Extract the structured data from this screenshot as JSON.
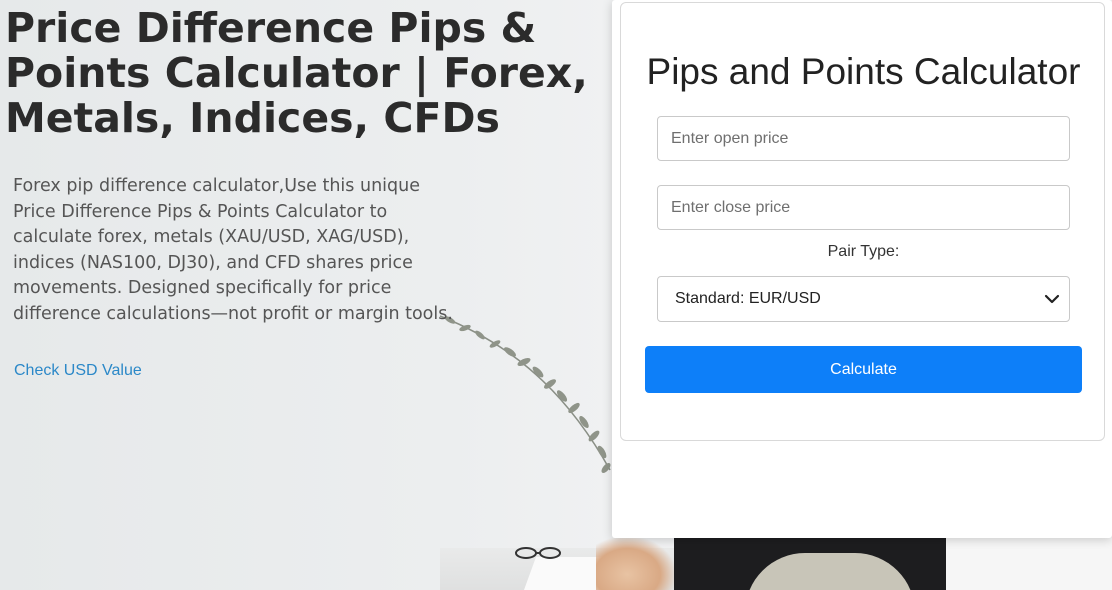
{
  "hero": {
    "title_line1": "Price Difference Pips &",
    "title_line2": "Points Calculator | Forex,",
    "title_line3": "Metals, Indices, CFDs",
    "description": "Forex pip difference calculator,Use this unique Price Difference Pips & Points Calculator to calculate forex, metals (XAU/USD, XAG/USD), indices (NAS100, DJ30), and CFD shares price movements. Designed specifically for price difference calculations—not profit or margin tools.",
    "link_label": "Check USD Value"
  },
  "calculator": {
    "title": "Pips and Points Calculator",
    "open_price": {
      "placeholder": "Enter open price",
      "value": ""
    },
    "close_price": {
      "placeholder": "Enter close price",
      "value": ""
    },
    "pair_type_label": "Pair Type:",
    "pair_type_selected": "Standard: EUR/USD",
    "calculate_label": "Calculate"
  },
  "colors": {
    "accent": "#0d7ff9",
    "link": "#2b88c8",
    "heading": "#2b2b2b"
  },
  "icons": {
    "select_chevron": "chevron-down-icon"
  }
}
